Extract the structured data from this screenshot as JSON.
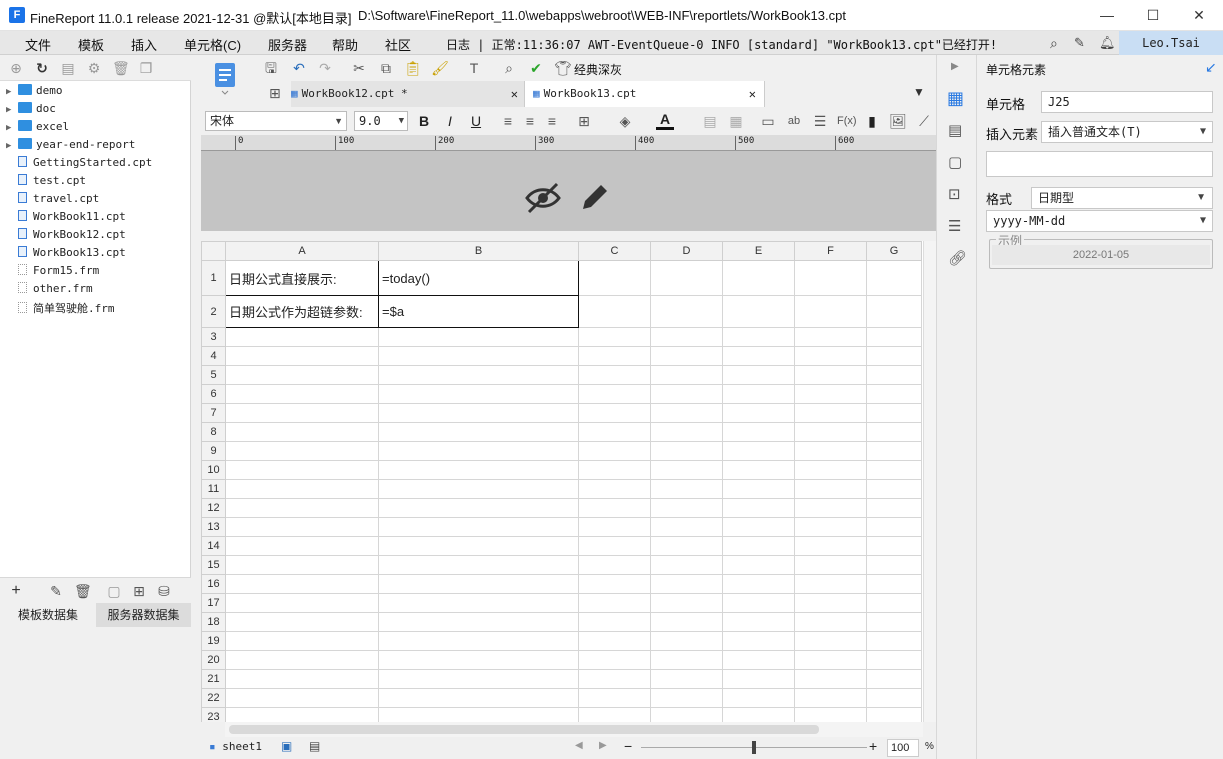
{
  "titlebar": {
    "title": "FineReport 11.0.1 release 2021-12-31 @默认[本地目录]",
    "path": "D:\\Software\\FineReport_11.0\\webapps\\webroot\\WEB-INF\\reportlets/WorkBook13.cpt",
    "minimize": "—",
    "maximize": "☐",
    "close": "✕"
  },
  "menubar": {
    "items": [
      "文件",
      "模板",
      "插入",
      "单元格(C)",
      "服务器",
      "帮助",
      "社区"
    ],
    "log": "日志 | 正常:11:36:07 AWT-EventQueue-0 INFO [standard] \"WorkBook13.cpt\"已经打开!",
    "user": "Leo.Tsai"
  },
  "tree": {
    "items": [
      {
        "label": "demo",
        "type": "folder"
      },
      {
        "label": "doc",
        "type": "folder"
      },
      {
        "label": "excel",
        "type": "folder"
      },
      {
        "label": "year-end-report",
        "type": "folder"
      },
      {
        "label": "GettingStarted.cpt",
        "type": "cpt"
      },
      {
        "label": "test.cpt",
        "type": "cpt"
      },
      {
        "label": "travel.cpt",
        "type": "cpt"
      },
      {
        "label": "WorkBook11.cpt",
        "type": "cpt"
      },
      {
        "label": "WorkBook12.cpt",
        "type": "cpt"
      },
      {
        "label": "WorkBook13.cpt",
        "type": "cpt"
      },
      {
        "label": "Form15.frm",
        "type": "frm"
      },
      {
        "label": "other.frm",
        "type": "frm"
      },
      {
        "label": "简单驾驶舱.frm",
        "type": "frm"
      }
    ]
  },
  "datasets": {
    "tab1": "模板数据集",
    "tab2": "服务器数据集"
  },
  "toolbar": {
    "theme_label": "经典深灰"
  },
  "tabs": [
    {
      "label": "WorkBook12.cpt *"
    },
    {
      "label": "WorkBook13.cpt"
    }
  ],
  "format_bar": {
    "font": "宋体",
    "size": "9.0"
  },
  "ruler": {
    "ticks": [
      "0",
      "100",
      "200",
      "300",
      "400",
      "500",
      "600"
    ]
  },
  "grid": {
    "columns": [
      "A",
      "B",
      "C",
      "D",
      "E",
      "F",
      "G"
    ],
    "rows": [
      {
        "num": "1",
        "a": "日期公式直接展示:",
        "b": "=today()"
      },
      {
        "num": "2",
        "a": "日期公式作为超链参数:",
        "b": "=$a"
      },
      {
        "num": "3"
      },
      {
        "num": "4"
      },
      {
        "num": "5"
      },
      {
        "num": "6"
      },
      {
        "num": "7"
      },
      {
        "num": "8"
      },
      {
        "num": "9"
      },
      {
        "num": "10"
      },
      {
        "num": "11"
      },
      {
        "num": "12"
      },
      {
        "num": "13"
      },
      {
        "num": "14"
      },
      {
        "num": "15"
      },
      {
        "num": "16"
      },
      {
        "num": "17"
      },
      {
        "num": "18"
      },
      {
        "num": "19"
      },
      {
        "num": "20"
      },
      {
        "num": "21"
      },
      {
        "num": "22"
      },
      {
        "num": "23"
      }
    ]
  },
  "sheetbar": {
    "sheet": "sheet1",
    "zoom": "100",
    "zoom_unit": "%",
    "zoom_level": 1.0
  },
  "rightpanel": {
    "title": "单元格元素",
    "cell_label": "单元格",
    "cell_value": "J25",
    "insert_label": "插入元素",
    "insert_value": "插入普通文本(T)",
    "format_label": "格式",
    "format_value": "日期型",
    "pattern_value": "yyyy-MM-dd",
    "example_label": "示例",
    "example_value": "2022-01-05"
  },
  "colors": {
    "accent": "#1a73e8",
    "user_bg": "#c9def4",
    "header_gray": "#c4c4c4"
  }
}
